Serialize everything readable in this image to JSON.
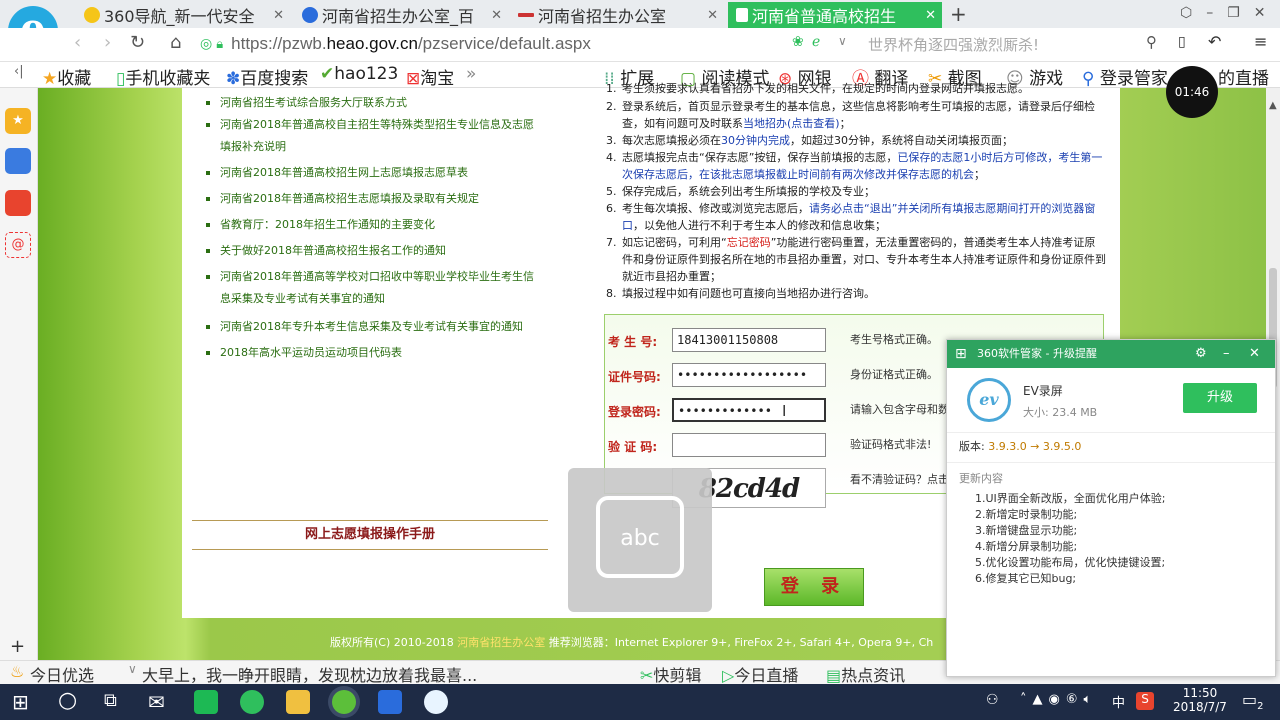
{
  "browser": {
    "tabs": [
      {
        "title": "360导航_新一代安全"
      },
      {
        "title": "河南省招生办公室_百"
      },
      {
        "title": "河南省招生办公室"
      },
      {
        "title": "河南省普通高校招生"
      }
    ],
    "new_tab": "+",
    "url_host": "https://pzwb.",
    "url_domain": "heao.gov.cn",
    "url_path": "/pzservice/default.aspx",
    "search_text": "世界杯角逐四强激烈厮杀!",
    "timer": "01:46"
  },
  "bookmarks": {
    "items": [
      "收藏",
      "手机收藏夹",
      "百度搜索",
      "hao123",
      "淘宝",
      "»"
    ],
    "right_items": [
      "扩展",
      "阅读模式",
      "网银",
      "翻译",
      "截图",
      "游戏",
      "登录管家",
      "的直播"
    ]
  },
  "links": [
    "河南省招生考试综合服务大厅联系方式",
    "河南省2018年普通高校自主招生等特殊类型招生专业信息及志愿填报补充说明",
    "河南省2018年普通高校招生网上志愿填报志愿草表",
    "河南省2018年普通高校招生志愿填报及录取有关规定",
    "省教育厅：2018年招生工作通知的主要变化",
    "关于做好2018年普通高校招生报名工作的通知",
    "河南省2018年普通高等学校对口招收中等职业学校毕业生考生信息采集及专业考试有关事宜的通知",
    "河南省2018年专升本考生信息采集及专业考试有关事宜的通知",
    "2018年高水平运动员运动项目代码表"
  ],
  "manual_title": "网上志愿填报操作手册",
  "notes": [
    {
      "n": "1.",
      "a": "考生须按要求认真看省招办下发的相关文件，在规定的时间内登录网站并填报志愿。",
      "r": "",
      "b": "",
      "c": ""
    },
    {
      "n": "2.",
      "a": "登录系统后，首页显示登录考生的基本信息，这些信息将影响考生可填报的志愿，请登录后仔细检查，如有问题可及时联系",
      "r": "",
      "b": "当地招办(点击查看)",
      "c": "；"
    },
    {
      "n": "3.",
      "a": "每次志愿填报必须在",
      "r": "",
      "b": "30分钟内完成",
      "c": "，如超过30分钟，系统将自动关闭填报页面；"
    },
    {
      "n": "4.",
      "a": "志愿填报完点击“保存志愿”按钮，保存当前填报的志愿，",
      "r": "",
      "b": "已保存的志愿1小时后方可修改，考生第一次保存志愿后，在该批志愿填报截止时间前有两次修改并保存志愿的机会",
      "c": "；"
    },
    {
      "n": "5.",
      "a": "保存完成后，系统会列出考生所填报的学校及专业；",
      "r": "",
      "b": "",
      "c": ""
    },
    {
      "n": "6.",
      "a": "考生每次填报、修改或浏览完志愿后，",
      "r": "",
      "b": "请务必点击“退出”并关闭所有填报志愿期间打开的浏览器窗口",
      "c": "，以免他人进行不利于考生本人的修改和信息收集；"
    },
    {
      "n": "7.",
      "a": "如忘记密码，可利用“",
      "r": "忘记密码",
      "b": "",
      "c": "”功能进行密码重置，无法重置密码的，普通类考生本人持准考证原件和身份证原件到报名所在地的市县招办重置，对口、专升本考生本人持准考证原件和身份证原件到就近市县招办重置；"
    },
    {
      "n": "8.",
      "a": "填报过程中如有问题也可直接向当地招办进行咨询。",
      "r": "",
      "b": "",
      "c": ""
    }
  ],
  "form": {
    "exam_label": "考 生 号:",
    "exam_value": "18413001150808",
    "exam_hint": "考生号格式正确。",
    "id_label": "证件号码:",
    "id_value": "••••••••••••••••••",
    "id_hint": "身份证格式正确。",
    "pwd_label": "登录密码:",
    "pwd_value": "•••••••••••••",
    "pwd_hint": "请输入包含字母和数",
    "code_label": "验 证 码:",
    "code_value": "",
    "code_hint": "验证码格式非法!",
    "captcha": "82cd4d",
    "captcha_hint": "看不清验证码？点击",
    "login": "登 录"
  },
  "footer": {
    "copyright": "版权所有(C) 2010-2018",
    "org": "河南省招生办公室",
    "browsers": "推荐浏览器：Internet Explorer 9+, FireFox 2+, Safari 4+, Opera 9+, Ch"
  },
  "keyboard": {
    "label": "abc"
  },
  "popup": {
    "title": "360软件管家 - 升级提醒",
    "app_name": "EV录屏",
    "size": "大小: 23.4 MB",
    "upgrade": "升级",
    "version_label": "版本:",
    "version_old": "3.9.3.0",
    "arrow": "→",
    "version_new": "3.9.5.0",
    "changes_label": "更新内容",
    "changes": [
      "1.UI界面全新改版，全面优化用户体验;",
      "2.新增定时录制功能;",
      "3.新增键盘显示功能;",
      "4.新增分屏录制功能;",
      "5.优化设置功能布局，优化快捷键设置;",
      "6.修复其它已知bug;"
    ]
  },
  "newsbar": {
    "today": "今日优选",
    "headline": "大早上，我一睁开眼睛，发现枕边放着我最喜...",
    "right": [
      "快剪辑",
      "今日直播",
      "热点资讯"
    ]
  },
  "taskbar": {
    "time": "11:50",
    "date": "2018/7/7",
    "ime": "中",
    "notif": "2"
  },
  "colors": {
    "brand_green": "#2fbf5d",
    "link_green": "#2b6e12",
    "alert_red": "#d6201b",
    "note_blue": "#1a3fb0"
  }
}
